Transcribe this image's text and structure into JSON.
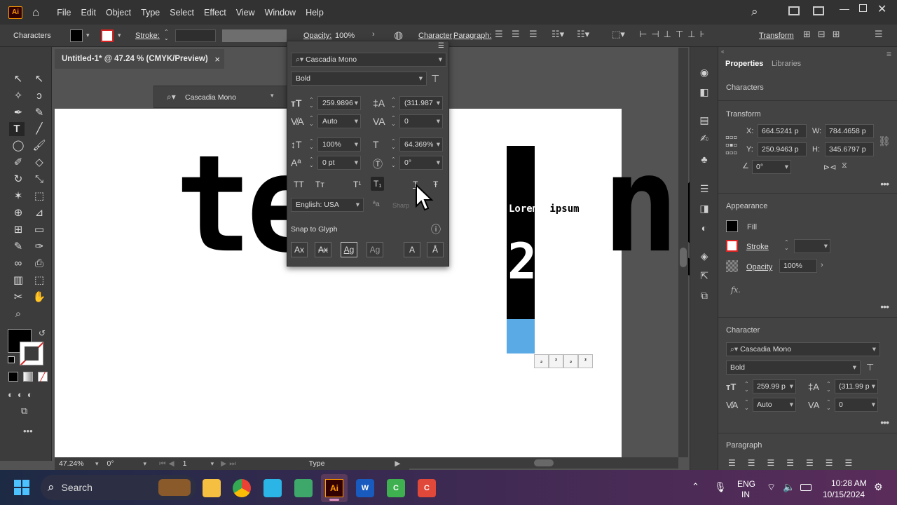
{
  "app": {
    "logo": "Ai",
    "menu": [
      "File",
      "Edit",
      "Object",
      "Type",
      "Select",
      "Effect",
      "View",
      "Window",
      "Help"
    ]
  },
  "control_bar": {
    "mode_label": "Characters",
    "stroke_label": "Stroke:",
    "opacity_label": "Opacity:",
    "opacity_value": "100%",
    "character_label": "Character",
    "paragraph_label": "Paragraph:",
    "transform_label": "Transform"
  },
  "document_tab": {
    "title": "Untitled-1* @ 47.24 % (CMYK/Preview)",
    "close": "×"
  },
  "artboard": {
    "big_text": "tes   ng",
    "lorem": "Lorem",
    "ipsum": " ipsum",
    "digit": "2",
    "glyphs": [
      "₂",
      "²",
      "₂",
      "²"
    ]
  },
  "float_bar": {
    "font": "Cascadia Mono"
  },
  "character_panel": {
    "font_family": "Cascadia Mono",
    "font_style": "Bold",
    "font_size": "259.9896",
    "leading": "(311.987",
    "kerning": "Auto",
    "tracking": "0",
    "vertical_scale": "100%",
    "horizontal_scale": "64.369%",
    "baseline_shift": "0 pt",
    "rotation": "0°",
    "language": "English: USA",
    "anti_alias": "Sharp",
    "snap_to_glyph": "Snap to Glyph",
    "caps_buttons": [
      "TT",
      "Tт",
      "T¹",
      "T₁",
      "T",
      "Ŧ"
    ]
  },
  "status_bar": {
    "zoom": "47.24%",
    "rotation": "0°",
    "artboard": "1",
    "tool": "Type"
  },
  "properties": {
    "tabs": [
      "Properties",
      "Libraries"
    ],
    "section_characters": "Characters",
    "section_transform": "Transform",
    "x_label": "X:",
    "x": "664.5241 p",
    "y_label": "Y:",
    "y": "250.9463 p",
    "w_label": "W:",
    "w": "784.4658 p",
    "h_label": "H:",
    "h": "345.6797 p",
    "angle": "0°",
    "section_appearance": "Appearance",
    "fill": "Fill",
    "stroke": "Stroke",
    "opacity": "Opacity",
    "opacity_value": "100%",
    "fx": "fx.",
    "section_character": "Character",
    "font_family": "Cascadia Mono",
    "font_style": "Bold",
    "font_size": "259.99 p",
    "leading": "(311.99 p",
    "kerning": "Auto",
    "tracking": "0",
    "section_paragraph": "Paragraph"
  },
  "taskbar": {
    "search": "Search",
    "lang1": "ENG",
    "lang2": "IN",
    "time": "10:28 AM",
    "date": "10/15/2024"
  },
  "colors": {
    "accent": "#ff9a00",
    "fill_swatch": "#000000",
    "blue_rect": "#5aaae6"
  }
}
